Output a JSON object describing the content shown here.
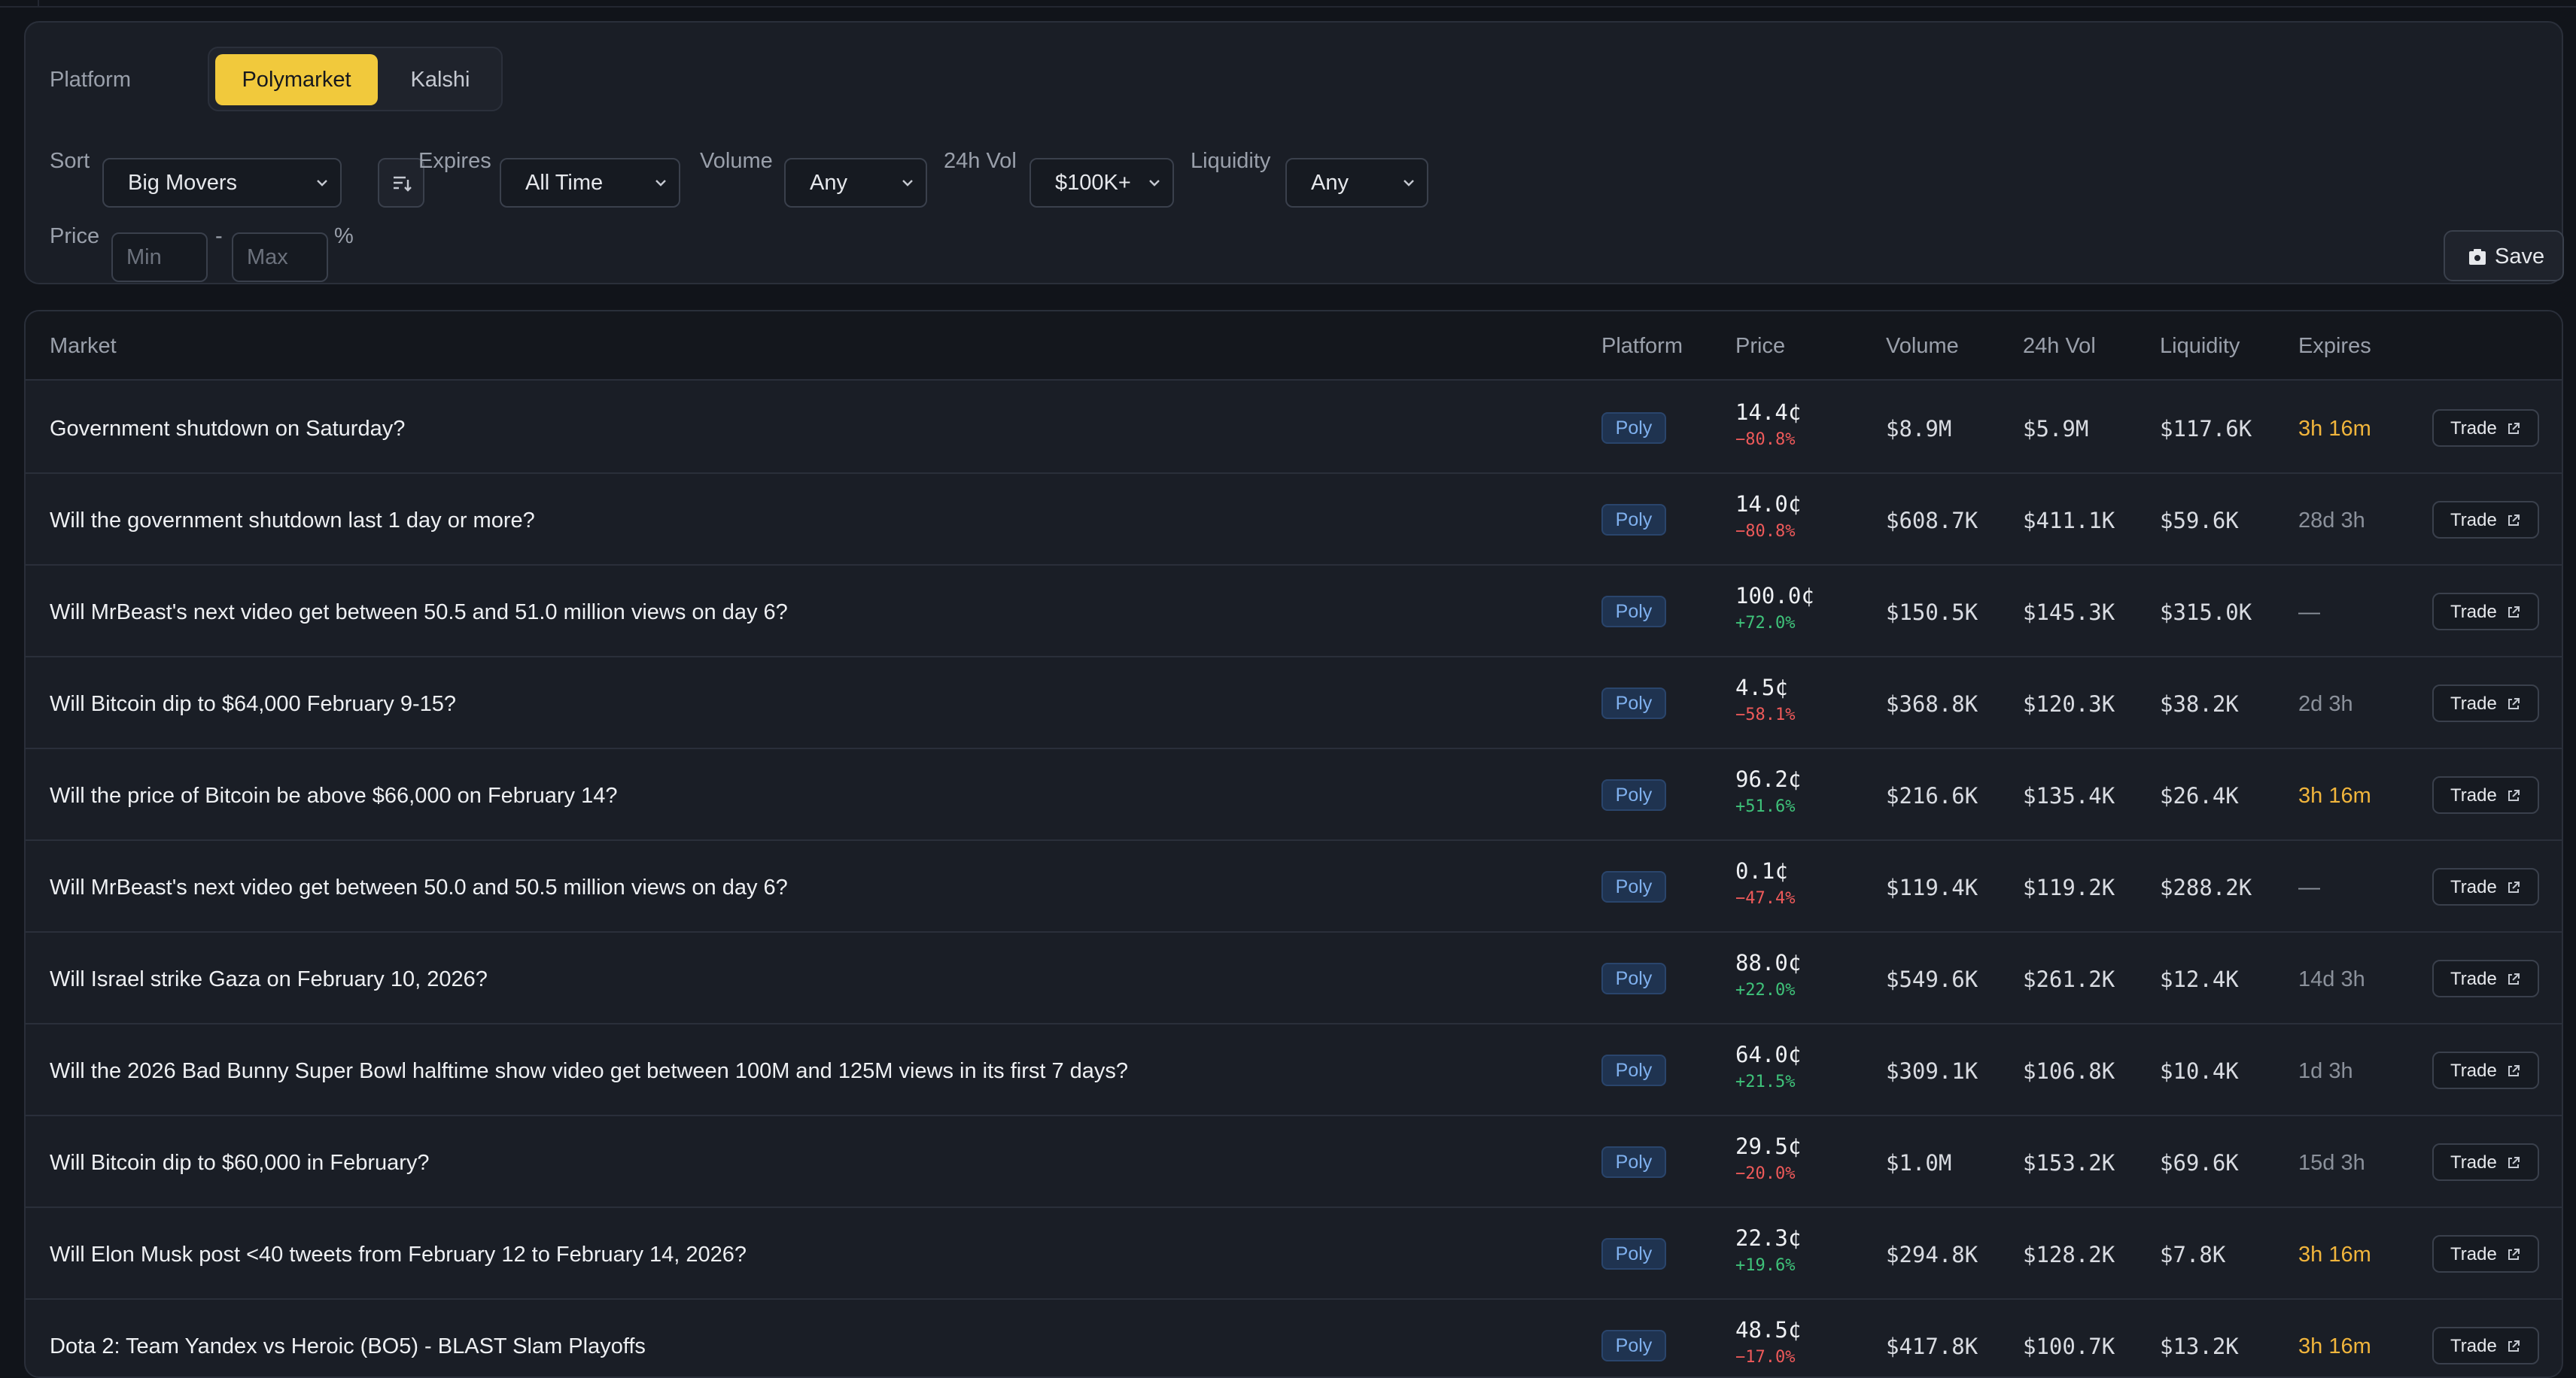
{
  "filters": {
    "platform_label": "Platform",
    "platforms": [
      "Polymarket",
      "Kalshi"
    ],
    "sort_label": "Sort",
    "sort_value": "Big Movers",
    "expires_label": "Expires",
    "expires_value": "All Time",
    "volume_label": "Volume",
    "volume_value": "Any",
    "vol24_label": "24h Vol",
    "vol24_value": "$100K+",
    "liquidity_label": "Liquidity",
    "liquidity_value": "Any",
    "price_label": "Price",
    "min_placeholder": "Min",
    "max_placeholder": "Max",
    "dash": "-",
    "percent": "%",
    "save_label": "Save"
  },
  "table": {
    "headers": [
      "Market",
      "Platform",
      "Price",
      "Volume",
      "24h Vol",
      "Liquidity",
      "Expires"
    ],
    "trade_label": "Trade",
    "rows": [
      {
        "market": "Government shutdown on Saturday?",
        "platform": "Poly",
        "price": "14.4¢",
        "change": "−80.8%",
        "dir": "neg",
        "volume": "$8.9M",
        "vol24": "$5.9M",
        "liquidity": "$117.6K",
        "expires": "3h 16m",
        "hot": true
      },
      {
        "market": "Will the government shutdown last 1 day or more?",
        "platform": "Poly",
        "price": "14.0¢",
        "change": "−80.8%",
        "dir": "neg",
        "volume": "$608.7K",
        "vol24": "$411.1K",
        "liquidity": "$59.6K",
        "expires": "28d 3h",
        "hot": false
      },
      {
        "market": "Will MrBeast's next video get between 50.5 and 51.0 million views on day 6?",
        "platform": "Poly",
        "price": "100.0¢",
        "change": "+72.0%",
        "dir": "pos",
        "volume": "$150.5K",
        "vol24": "$145.3K",
        "liquidity": "$315.0K",
        "expires": "—",
        "hot": false
      },
      {
        "market": "Will Bitcoin dip to $64,000 February 9-15?",
        "platform": "Poly",
        "price": "4.5¢",
        "change": "−58.1%",
        "dir": "neg",
        "volume": "$368.8K",
        "vol24": "$120.3K",
        "liquidity": "$38.2K",
        "expires": "2d 3h",
        "hot": false
      },
      {
        "market": "Will the price of Bitcoin be above $66,000 on February 14?",
        "platform": "Poly",
        "price": "96.2¢",
        "change": "+51.6%",
        "dir": "pos",
        "volume": "$216.6K",
        "vol24": "$135.4K",
        "liquidity": "$26.4K",
        "expires": "3h 16m",
        "hot": true
      },
      {
        "market": "Will MrBeast's next video get between 50.0 and 50.5 million views on day 6?",
        "platform": "Poly",
        "price": "0.1¢",
        "change": "−47.4%",
        "dir": "neg",
        "volume": "$119.4K",
        "vol24": "$119.2K",
        "liquidity": "$288.2K",
        "expires": "—",
        "hot": false
      },
      {
        "market": "Will Israel strike Gaza on February 10, 2026?",
        "platform": "Poly",
        "price": "88.0¢",
        "change": "+22.0%",
        "dir": "pos",
        "volume": "$549.6K",
        "vol24": "$261.2K",
        "liquidity": "$12.4K",
        "expires": "14d 3h",
        "hot": false
      },
      {
        "market": "Will the 2026 Bad Bunny Super Bowl halftime show video get between 100M and 125M views in its first 7 days?",
        "platform": "Poly",
        "price": "64.0¢",
        "change": "+21.5%",
        "dir": "pos",
        "volume": "$309.1K",
        "vol24": "$106.8K",
        "liquidity": "$10.4K",
        "expires": "1d 3h",
        "hot": false
      },
      {
        "market": "Will Bitcoin dip to $60,000 in February?",
        "platform": "Poly",
        "price": "29.5¢",
        "change": "−20.0%",
        "dir": "neg",
        "volume": "$1.0M",
        "vol24": "$153.2K",
        "liquidity": "$69.6K",
        "expires": "15d 3h",
        "hot": false
      },
      {
        "market": "Will Elon Musk post <40 tweets from February 12 to February 14, 2026?",
        "platform": "Poly",
        "price": "22.3¢",
        "change": "+19.6%",
        "dir": "pos",
        "volume": "$294.8K",
        "vol24": "$128.2K",
        "liquidity": "$7.8K",
        "expires": "3h 16m",
        "hot": true
      },
      {
        "market": "Dota 2: Team Yandex vs Heroic (BO5) - BLAST Slam Playoffs",
        "platform": "Poly",
        "price": "48.5¢",
        "change": "−17.0%",
        "dir": "neg",
        "volume": "$417.8K",
        "vol24": "$100.7K",
        "liquidity": "$13.2K",
        "expires": "3h 16m",
        "hot": true
      }
    ]
  }
}
